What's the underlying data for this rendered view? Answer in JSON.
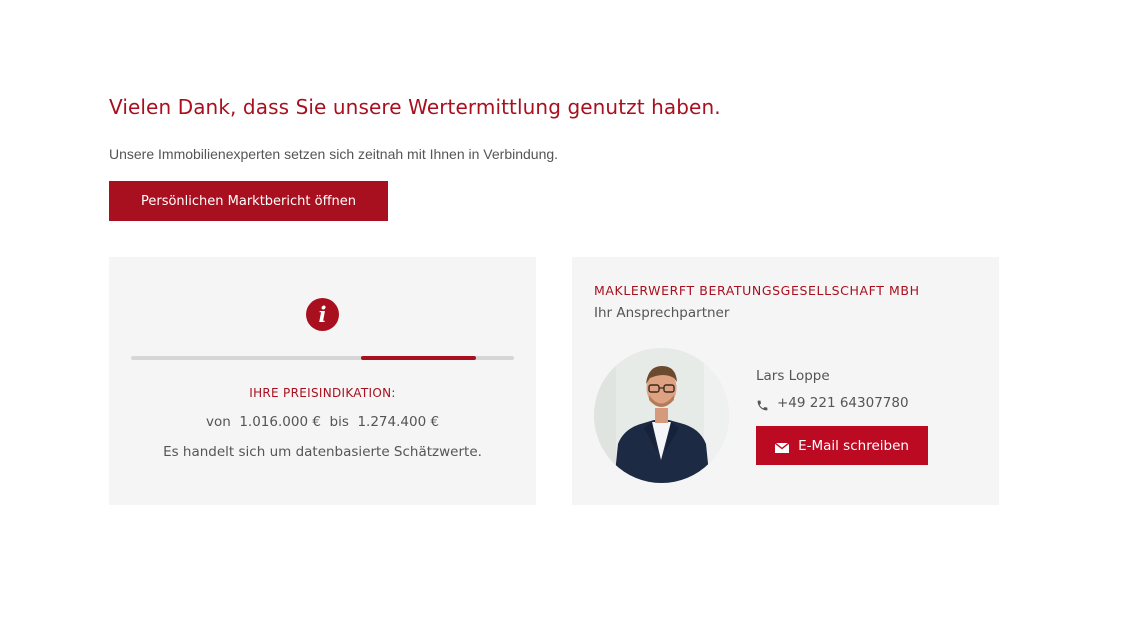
{
  "header": {
    "title": "Vielen Dank, dass Sie unsere Wertermittlung genutzt haben.",
    "subtitle": "Unsere Immobilienexperten setzen sich zeitnah mit Ihnen in Verbindung.",
    "report_button_label": "Persönlichen Marktbericht öffnen"
  },
  "price_card": {
    "icon": "info-icon",
    "range_indicator": {
      "start_fraction": 0.6,
      "end_fraction": 0.9
    },
    "label": "IHRE PREISINDIKATION:",
    "range_text": "von  1.016.000 €  bis  1.274.400 €",
    "note": "Es handelt sich um datenbasierte Schätzwerte."
  },
  "contact_card": {
    "company": "MAKLERWERFT BERATUNGSGESELLSCHAFT MBH",
    "role": "Ihr Ansprechpartner",
    "name": "Lars Loppe",
    "phone_icon": "phone-icon",
    "phone": "+49 221 64307780",
    "email_icon": "mail-icon",
    "email_button_label": "E-Mail schreiben"
  },
  "colors": {
    "accent": "#a8101f",
    "button": "#bb0a21",
    "card_background": "#f5f5f5",
    "text_gray": "#555555",
    "track_gray": "#d6d6d6"
  }
}
